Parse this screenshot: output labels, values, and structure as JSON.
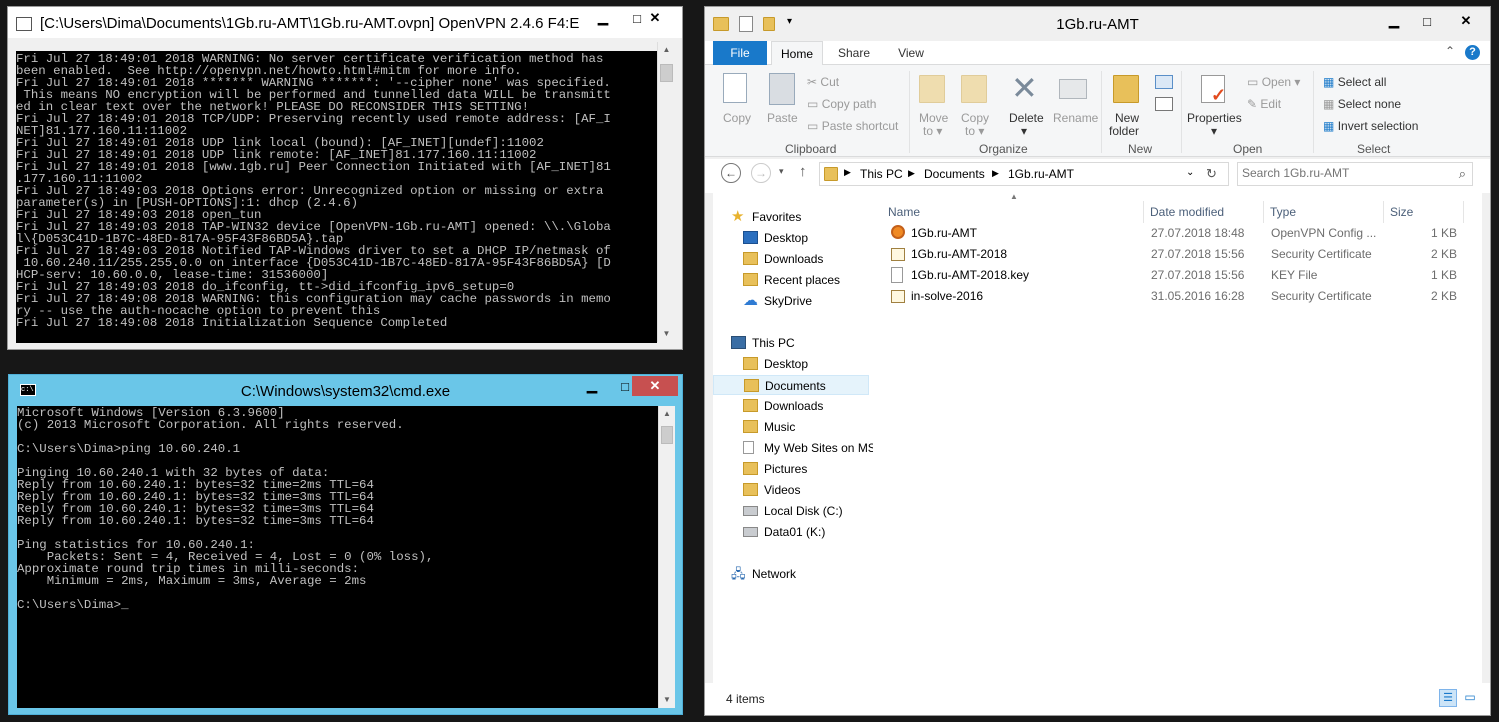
{
  "openvpn": {
    "title": "[C:\\Users\\Dima\\Documents\\1Gb.ru-AMT\\1Gb.ru-AMT.ovpn] OpenVPN 2.4.6 F4:E...",
    "log": [
      "Fri Jul 27 18:49:01 2018 WARNING: No server certificate verification method has",
      "been enabled.  See http://openvpn.net/howto.html#mitm for more info.",
      "Fri Jul 27 18:49:01 2018 ******* WARNING *******: '--cipher none' was specified.",
      " This means NO encryption will be performed and tunnelled data WILL be transmitt",
      "ed in clear text over the network! PLEASE DO RECONSIDER THIS SETTING!",
      "Fri Jul 27 18:49:01 2018 TCP/UDP: Preserving recently used remote address: [AF_I",
      "NET]81.177.160.11:11002",
      "Fri Jul 27 18:49:01 2018 UDP link local (bound): [AF_INET][undef]:11002",
      "Fri Jul 27 18:49:01 2018 UDP link remote: [AF_INET]81.177.160.11:11002",
      "Fri Jul 27 18:49:01 2018 [www.1gb.ru] Peer Connection Initiated with [AF_INET]81",
      ".177.160.11:11002",
      "Fri Jul 27 18:49:03 2018 Options error: Unrecognized option or missing or extra",
      "parameter(s) in [PUSH-OPTIONS]:1: dhcp (2.4.6)",
      "Fri Jul 27 18:49:03 2018 open_tun",
      "Fri Jul 27 18:49:03 2018 TAP-WIN32 device [OpenVPN-1Gb.ru-AMT] opened: \\\\.\\Globa",
      "l\\{D053C41D-1B7C-48ED-817A-95F43F86BD5A}.tap",
      "Fri Jul 27 18:49:03 2018 Notified TAP-Windows driver to set a DHCP IP/netmask of",
      " 10.60.240.11/255.255.0.0 on interface {D053C41D-1B7C-48ED-817A-95F43F86BD5A} [D",
      "HCP-serv: 10.60.0.0, lease-time: 31536000]",
      "Fri Jul 27 18:49:03 2018 do_ifconfig, tt->did_ifconfig_ipv6_setup=0",
      "Fri Jul 27 18:49:08 2018 WARNING: this configuration may cache passwords in memo",
      "ry -- use the auth-nocache option to prevent this",
      "Fri Jul 27 18:49:08 2018 Initialization Sequence Completed"
    ]
  },
  "cmd": {
    "title": "C:\\Windows\\system32\\cmd.exe",
    "lines": [
      "Microsoft Windows [Version 6.3.9600]",
      "(c) 2013 Microsoft Corporation. All rights reserved.",
      "",
      "C:\\Users\\Dima>ping 10.60.240.1",
      "",
      "Pinging 10.60.240.1 with 32 bytes of data:",
      "Reply from 10.60.240.1: bytes=32 time=2ms TTL=64",
      "Reply from 10.60.240.1: bytes=32 time=3ms TTL=64",
      "Reply from 10.60.240.1: bytes=32 time=3ms TTL=64",
      "Reply from 10.60.240.1: bytes=32 time=3ms TTL=64",
      "",
      "Ping statistics for 10.60.240.1:",
      "    Packets: Sent = 4, Received = 4, Lost = 0 (0% loss),",
      "Approximate round trip times in milli-seconds:",
      "    Minimum = 2ms, Maximum = 3ms, Average = 2ms",
      "",
      "C:\\Users\\Dima>_"
    ]
  },
  "explorer": {
    "title": "1Gb.ru-AMT",
    "tabs": {
      "file": "File",
      "home": "Home",
      "share": "Share",
      "view": "View"
    },
    "ribbon": {
      "copy": "Copy",
      "paste": "Paste",
      "cut": "Cut",
      "copy_path": "Copy path",
      "paste_shortcut": "Paste shortcut",
      "move_to": "Move",
      "move_to2": "to ▾",
      "copy_to": "Copy",
      "copy_to2": "to ▾",
      "delete": "Delete",
      "delete2": "▾",
      "rename": "Rename",
      "new_folder": "New",
      "new_folder2": "folder",
      "properties": "Properties",
      "properties2": "▾",
      "open": "Open ▾",
      "edit": "Edit",
      "select_all": "Select all",
      "select_none": "Select none",
      "invert_selection": "Invert selection",
      "groups": {
        "clipboard": "Clipboard",
        "organize": "Organize",
        "new": "New",
        "open": "Open",
        "select": "Select"
      }
    },
    "address": {
      "this_pc": "This PC",
      "documents": "Documents",
      "current": "1Gb.ru-AMT"
    },
    "search_placeholder": "Search 1Gb.ru-AMT",
    "nav": {
      "favorites": "Favorites",
      "fav_items": [
        "Desktop",
        "Downloads",
        "Recent places",
        "SkyDrive"
      ],
      "this_pc": "This PC",
      "pc_items": [
        "Desktop",
        "Documents",
        "Downloads",
        "Music",
        "My Web Sites on MS",
        "Pictures",
        "Videos",
        "Local Disk (C:)",
        "Data01 (K:)"
      ],
      "network": "Network"
    },
    "columns": {
      "name": "Name",
      "date": "Date modified",
      "type": "Type",
      "size": "Size"
    },
    "files": [
      {
        "name": "1Gb.ru-AMT",
        "date": "27.07.2018 18:48",
        "type": "OpenVPN Config ...",
        "size": "1 KB",
        "icon": "openvpn-icon"
      },
      {
        "name": "1Gb.ru-AMT-2018",
        "date": "27.07.2018 15:56",
        "type": "Security Certificate",
        "size": "2 KB",
        "icon": "certificate-icon"
      },
      {
        "name": "1Gb.ru-AMT-2018.key",
        "date": "27.07.2018 15:56",
        "type": "KEY File",
        "size": "1 KB",
        "icon": "file-icon"
      },
      {
        "name": "in-solve-2016",
        "date": "31.05.2016 16:28",
        "type": "Security Certificate",
        "size": "2 KB",
        "icon": "certificate-icon"
      }
    ],
    "status": "4 items"
  },
  "colors": {
    "accent_blue": "#1979ca",
    "window_frame": "#6ac6e8",
    "close_red": "#c75050"
  }
}
